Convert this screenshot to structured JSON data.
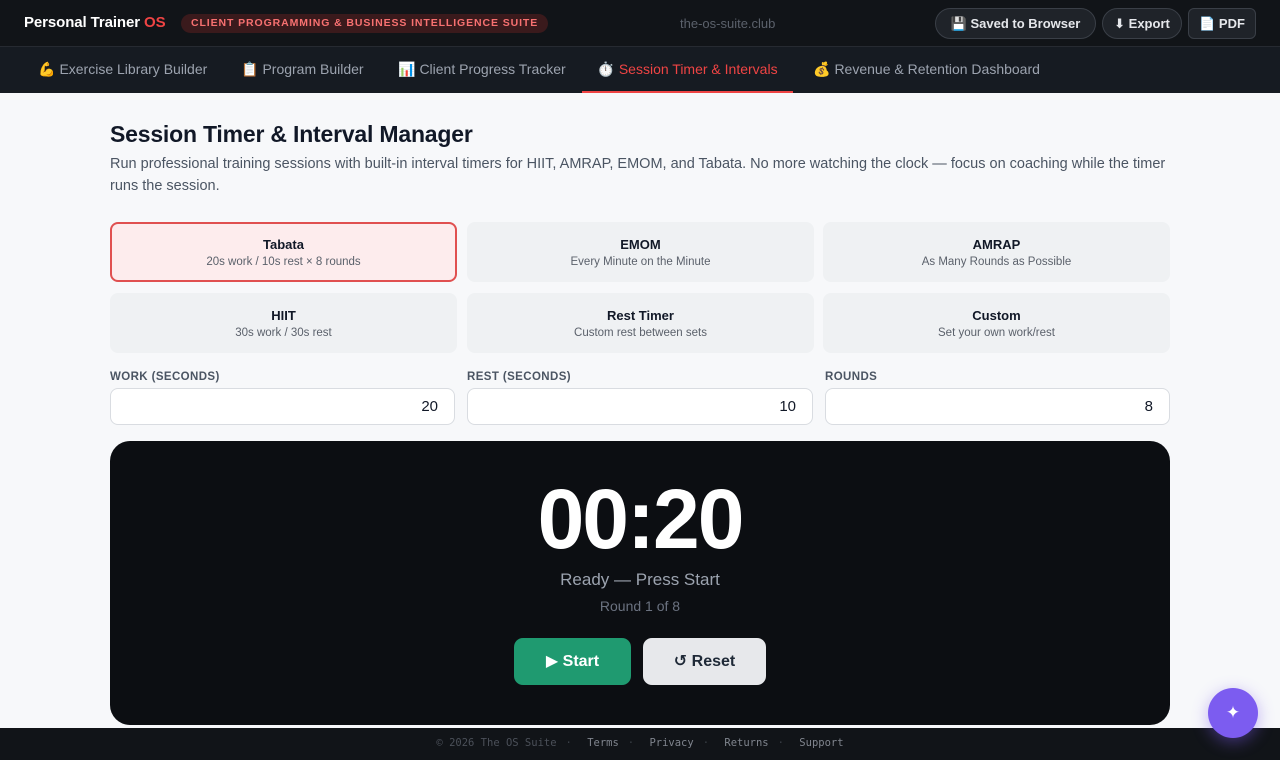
{
  "header": {
    "brand_main": "Personal Trainer",
    "brand_accent": "OS",
    "suite_badge": "CLIENT PROGRAMMING & BUSINESS INTELLIGENCE SUITE",
    "domain": "the-os-suite.club",
    "saved_label": "💾 Saved to Browser",
    "export_label": "⬇ Export",
    "pdf_label": "📄 PDF"
  },
  "tabs": [
    {
      "icon": "💪",
      "label": "Exercise Library Builder",
      "active": false
    },
    {
      "icon": "📋",
      "label": "Program Builder",
      "active": false
    },
    {
      "icon": "📊",
      "label": "Client Progress Tracker",
      "active": false
    },
    {
      "icon": "⏱️",
      "label": "Session Timer & Intervals",
      "active": true
    },
    {
      "icon": "💰",
      "label": "Revenue & Retention Dashboard",
      "active": false
    }
  ],
  "main": {
    "title": "Session Timer & Interval Manager",
    "description": "Run professional training sessions with built-in interval timers for HIIT, AMRAP, EMOM, and Tabata. No more watching the clock — focus on coaching while the timer runs the session."
  },
  "presets": [
    {
      "name": "Tabata",
      "desc": "20s work / 10s rest × 8 rounds",
      "selected": true
    },
    {
      "name": "EMOM",
      "desc": "Every Minute on the Minute",
      "selected": false
    },
    {
      "name": "AMRAP",
      "desc": "As Many Rounds as Possible",
      "selected": false
    },
    {
      "name": "HIIT",
      "desc": "30s work / 30s rest",
      "selected": false
    },
    {
      "name": "Rest Timer",
      "desc": "Custom rest between sets",
      "selected": false
    },
    {
      "name": "Custom",
      "desc": "Set your own work/rest",
      "selected": false
    }
  ],
  "fields": {
    "work_label": "WORK (SECONDS)",
    "work_value": "20",
    "rest_label": "REST (SECONDS)",
    "rest_value": "10",
    "rounds_label": "ROUNDS",
    "rounds_value": "8"
  },
  "timer": {
    "display": "00:20",
    "status": "Ready — Press Start",
    "round": "Round 1 of 8",
    "start_label": "▶ Start",
    "reset_label": "↺ Reset"
  },
  "footer": {
    "copyright": "© 2026 The OS Suite",
    "links": [
      "Terms",
      "Privacy",
      "Returns",
      "Support"
    ]
  },
  "fab": {
    "icon": "sparkle-icon",
    "glyph": "✦"
  },
  "colors": {
    "accent": "#ef4444",
    "start_green": "#1f9a70",
    "fab_purple": "#7c5cf0",
    "timer_bg": "#0c0e12"
  }
}
